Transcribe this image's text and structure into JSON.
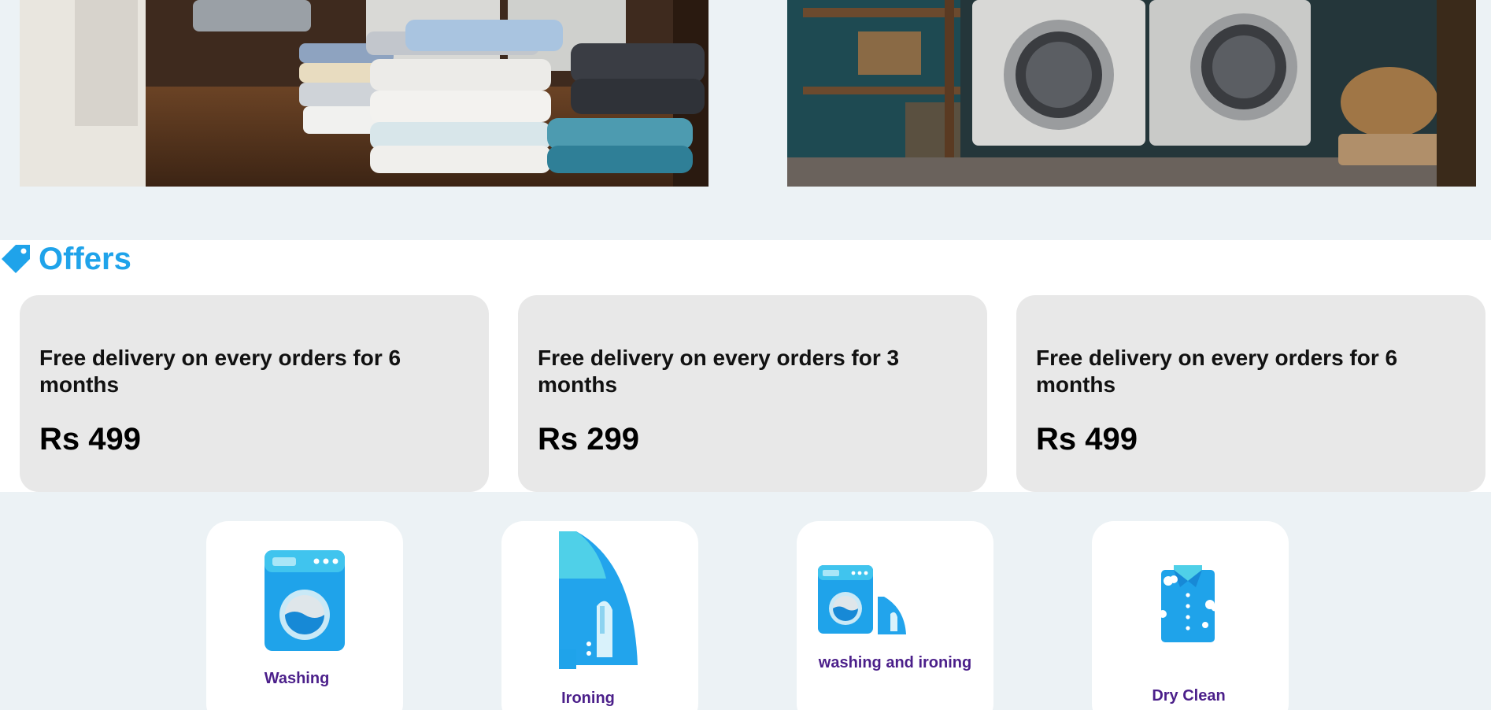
{
  "hero": {
    "images": [
      {
        "name": "folded-laundry-photo"
      },
      {
        "name": "washing-machines-photo"
      }
    ]
  },
  "offers": {
    "title": "Offers",
    "icon": "tag-icon",
    "accent_color": "#1fa3ea",
    "cards": [
      {
        "description": "Free delivery on every orders for 6 months",
        "price": "Rs 499"
      },
      {
        "description": "Free delivery on every orders for 3 months",
        "price": "Rs 299"
      },
      {
        "description": "Free delivery on every orders for 6 months",
        "price": "Rs 499"
      }
    ]
  },
  "services": {
    "label_color": "#4b1f8a",
    "items": [
      {
        "label": "Washing",
        "icon": "washing-machine-icon"
      },
      {
        "label": "Ironing",
        "icon": "iron-icon"
      },
      {
        "label": "washing and ironing",
        "icon": "washing-and-ironing-icon"
      },
      {
        "label": "Dry Clean",
        "icon": "shirt-icon"
      }
    ]
  }
}
